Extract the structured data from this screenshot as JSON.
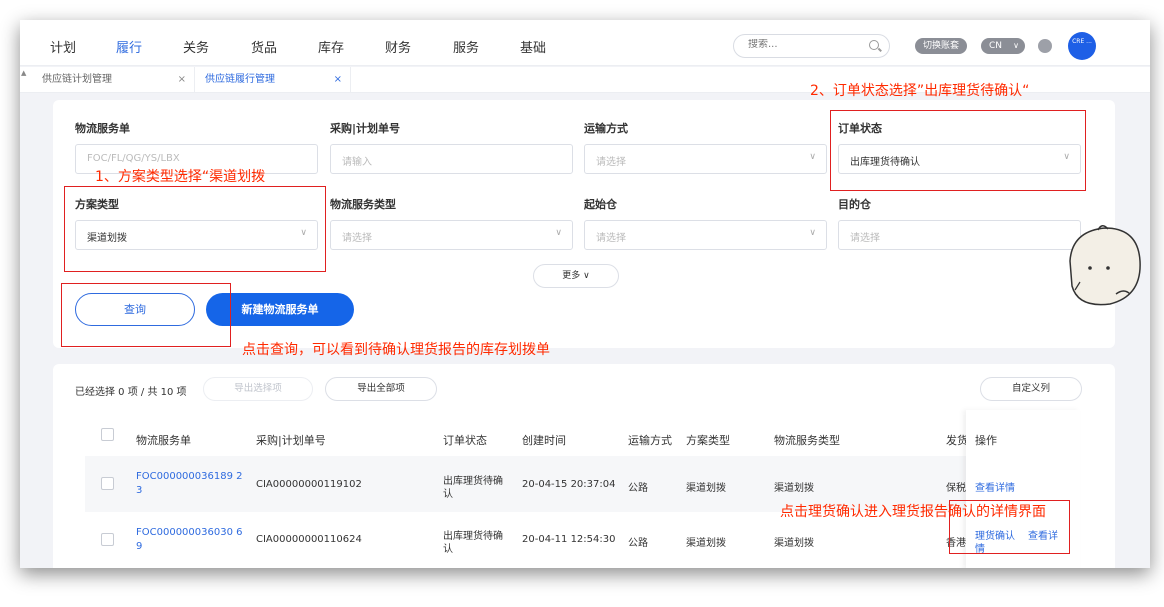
{
  "nav": {
    "items": [
      "计划",
      "履行",
      "关务",
      "货品",
      "库存",
      "财务",
      "服务",
      "基础"
    ],
    "active": "履行",
    "search_placeholder": "搜索...",
    "switch_account": "切换账套",
    "lang": "CN",
    "avatar_text": "CRE ...",
    "accent": "#1565e8"
  },
  "tabs": [
    {
      "label": "供应链计划管理",
      "close": "×"
    },
    {
      "label": "供应链履行管理",
      "close": "×"
    }
  ],
  "filters": {
    "service_no_label": "物流服务单",
    "service_no_placeholder": "FOC/FL/QG/YS/LBX",
    "purchase_label": "采购|计划单号",
    "purchase_placeholder": "请输入",
    "transport_label": "运输方式",
    "transport_placeholder": "请选择",
    "order_status_label": "订单状态",
    "order_status_value": "出库理货待确认",
    "plan_type_label": "方案类型",
    "plan_type_value": "渠道划拨",
    "service_type_label": "物流服务类型",
    "service_type_placeholder": "请选择",
    "origin_label": "起始仓",
    "origin_placeholder": "请选择",
    "dest_label": "目的仓",
    "dest_placeholder": "请选择",
    "more": "更多 ∨",
    "query_button": "查询",
    "create_button": "新建物流服务单"
  },
  "annotations": {
    "step1": "1、方案类型选择“渠道划拨",
    "step2": "2、订单状态选择”出库理货待确认“",
    "query_note": "点击查询，可以看到待确认理货报告的库存划拨单",
    "detail_note": "点击理货确认进入理货报告确认的详情界面"
  },
  "table": {
    "selection": "已经选择 0 项 / 共 10 项",
    "export_selected": "导出选择项",
    "export_all": "导出全部项",
    "customize": "自定义列",
    "headers": [
      "物流服务单",
      "采购|计划单号",
      "订单状态",
      "创建时间",
      "运输方式",
      "方案类型",
      "物流服务类型",
      "发货",
      "操作"
    ],
    "rows": [
      {
        "service_no_1": "FOC000000036189 2",
        "service_no_2": "3",
        "purchase_no": "CIA00000000119102",
        "status_1": "出库理货待确",
        "status_2": "认",
        "created": "20-04-15 20:37:04",
        "transport": "公路",
        "plan_type": "渠道划拨",
        "service_type": "渠道划拨",
        "ship": "保税",
        "op_view": "查看详情"
      },
      {
        "service_no_1": "FOC000000036030 6",
        "service_no_2": "9",
        "purchase_no": "CIA00000000110624",
        "status_1": "出库理货待确",
        "status_2": "认",
        "created": "20-04-11 12:54:30",
        "transport": "公路",
        "plan_type": "渠道划拨",
        "service_type": "渠道划拨",
        "ship": "香港",
        "op_confirm": "理货确认",
        "op_view_1": "查看详",
        "op_view_2": "情"
      }
    ]
  }
}
